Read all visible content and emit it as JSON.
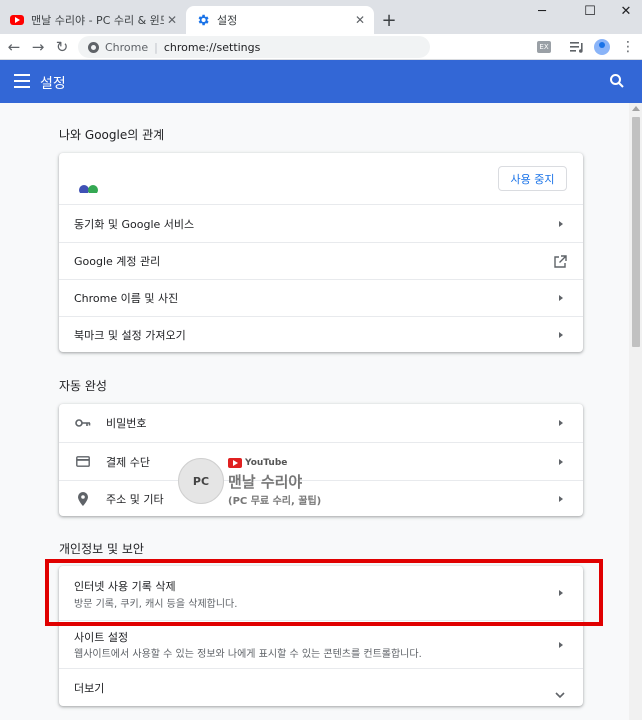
{
  "browser": {
    "tabs": [
      {
        "title": "맨날 수리야 - PC 수리 & 윈도우",
        "icon": "youtube-icon",
        "active": false
      },
      {
        "title": "설정",
        "icon": "gear-icon",
        "active": true
      }
    ],
    "new_tab": "+",
    "close": "✕",
    "window_controls": {
      "minimize": "─",
      "maximize": "☐",
      "close": "✕"
    }
  },
  "toolbar": {
    "back": "←",
    "forward": "→",
    "reload": "↻",
    "omnibox_chip": "Chrome",
    "omnibox_url": "chrome://settings",
    "extension_badge": "EX",
    "menu": "⋮"
  },
  "header": {
    "title": "설정"
  },
  "sections": {
    "you_and_google": {
      "title": "나와 Google의 관계",
      "stop_sync": "사용 중지",
      "items": [
        {
          "label": "동기화 및 Google 서비스"
        },
        {
          "label": "Google 계정 관리"
        },
        {
          "label": "Chrome 이름 및 사진"
        },
        {
          "label": "북마크 및 설정 가져오기"
        }
      ]
    },
    "autofill": {
      "title": "자동 완성",
      "items": [
        {
          "label": "비밀번호",
          "icon": "key-icon"
        },
        {
          "label": "결제 수단",
          "icon": "credit-card-icon"
        },
        {
          "label": "주소 및 기타",
          "icon": "location-pin-icon"
        }
      ]
    },
    "privacy": {
      "title": "개인정보 및 보안",
      "items": [
        {
          "label": "인터넷 사용 기록 삭제",
          "sublabel": "방문 기록, 쿠키, 캐시 등을 삭제합니다."
        },
        {
          "label": "사이트 설정",
          "sublabel": "웹사이트에서 사용할 수 있는 정보와 나에게 표시할 수 있는 콘텐츠를 컨트롤합니다."
        },
        {
          "label": "더보기"
        }
      ]
    }
  },
  "watermark": {
    "logo_text": "PC",
    "yt_label": "YouTube",
    "name": "맨날 수리야",
    "sub": "(PC 무료 수리, 꿀팁)"
  },
  "colors": {
    "header_blue": "#3367d6",
    "link_blue": "#1a73e8",
    "highlight_red": "#e00000"
  }
}
